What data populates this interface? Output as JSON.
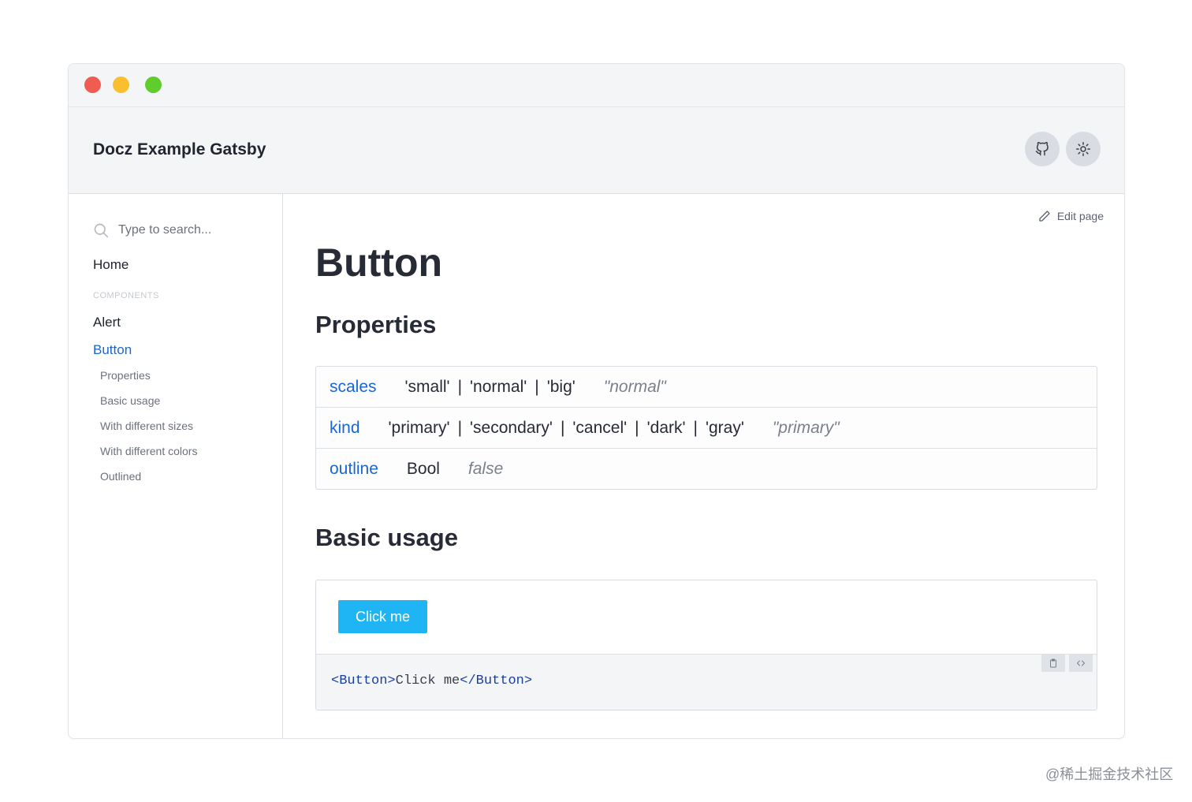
{
  "header": {
    "title": "Docz Example Gatsby"
  },
  "icons": {
    "github": "github-icon",
    "theme": "sun-icon",
    "search": "search-icon",
    "edit": "pencil-icon",
    "copy": "clipboard-icon",
    "code": "code-icon"
  },
  "colors": {
    "link": "#1a66d2",
    "button": "#1fb5f5",
    "traffic_red": "#f05b52",
    "traffic_yellow": "#f9bf2f",
    "traffic_green": "#5fcd2b"
  },
  "sidebar": {
    "search_placeholder": "Type to search...",
    "home": "Home",
    "section": "COMPONENTS",
    "items": [
      "Alert",
      "Button"
    ],
    "subitems": [
      "Properties",
      "Basic usage",
      "With different sizes",
      "With different colors",
      "Outlined"
    ]
  },
  "main": {
    "edit_label": "Edit page",
    "title": "Button",
    "properties_heading": "Properties",
    "basic_usage_heading": "Basic usage",
    "props": [
      {
        "name": "scales",
        "types": [
          "'small'",
          "'normal'",
          "'big'"
        ],
        "default": "\"normal\""
      },
      {
        "name": "kind",
        "types": [
          "'primary'",
          "'secondary'",
          "'cancel'",
          "'dark'",
          "'gray'"
        ],
        "default": "\"primary\""
      },
      {
        "name": "outline",
        "types": [
          "Bool"
        ],
        "default": "false"
      }
    ],
    "separator": "|",
    "demo_button": "Click me",
    "code": {
      "open_tag": "<Button>",
      "content": "Click me",
      "close_tag": "</Button>"
    }
  },
  "watermark": "@稀土掘金技术社区"
}
